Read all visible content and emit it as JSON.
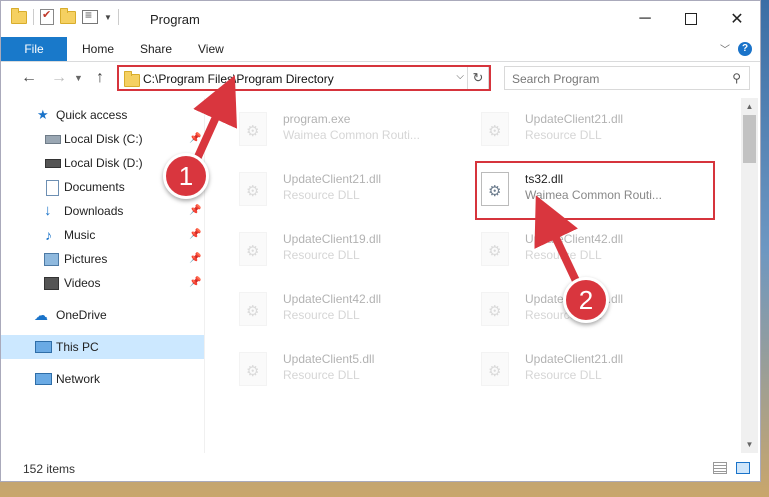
{
  "window": {
    "title": "Program",
    "minimize": "─",
    "close": "✕"
  },
  "ribbon": {
    "file": "File",
    "home": "Home",
    "share": "Share",
    "view": "View",
    "help": "?"
  },
  "address": {
    "path": "C:\\Program Files\\Program Directory",
    "search_placeholder": "Search Program"
  },
  "sidebar": {
    "items": [
      {
        "label": "Quick access"
      },
      {
        "label": "Local Disk (C:)"
      },
      {
        "label": "Local Disk (D:)"
      },
      {
        "label": "Documents"
      },
      {
        "label": "Downloads"
      },
      {
        "label": "Music"
      },
      {
        "label": "Pictures"
      },
      {
        "label": "Videos"
      },
      {
        "label": "OneDrive"
      },
      {
        "label": "This PC"
      },
      {
        "label": "Network"
      }
    ]
  },
  "files": [
    {
      "name": "program.exe",
      "desc": "Waimea Common Routi..."
    },
    {
      "name": "UpdateClient21.dll",
      "desc": "Resource DLL"
    },
    {
      "name": "UpdateClient21.dll",
      "desc": "Resource DLL"
    },
    {
      "name": "ts32.dll",
      "desc": "Waimea Common Routi..."
    },
    {
      "name": "UpdateClient19.dll",
      "desc": "Resource DLL"
    },
    {
      "name": "UpdateClient42.dll",
      "desc": "Resource DLL"
    },
    {
      "name": "UpdateClient42.dll",
      "desc": "Resource DLL"
    },
    {
      "name": "UpdateClient21.dll",
      "desc": "Resource DLL"
    },
    {
      "name": "UpdateClient5.dll",
      "desc": "Resource DLL"
    },
    {
      "name": "UpdateClient21.dll",
      "desc": "Resource DLL"
    }
  ],
  "status": {
    "item_count": "152 items"
  },
  "annotations": {
    "badge1": "1",
    "badge2": "2",
    "color": "#d9363e"
  },
  "colors": {
    "file_tab": "#1979ca",
    "selected_nav": "#cce8ff"
  }
}
